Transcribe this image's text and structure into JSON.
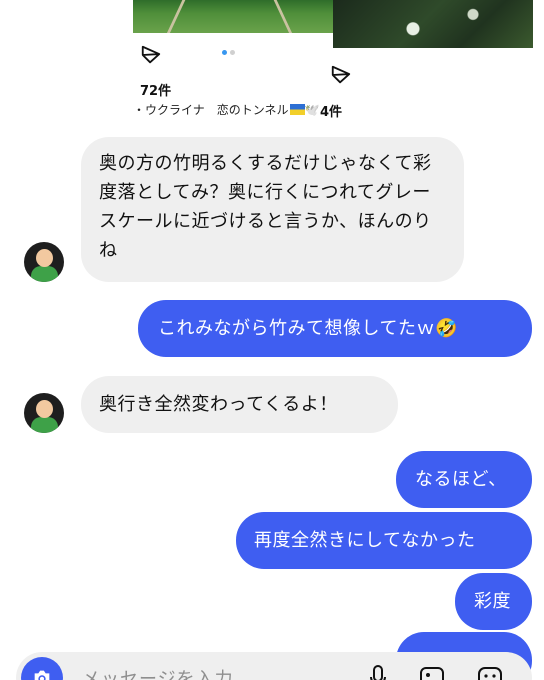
{
  "posts": [
    {
      "count": "72件",
      "caption_prefix": "・ウクライナ　恋のトンネル",
      "caption_suffix": "🕊️"
    },
    {
      "count": "4件"
    }
  ],
  "messages": [
    {
      "from": "other",
      "text": "奥の方の竹明るくするだけじゃなくて彩度落としてみ？奥に行くにつれてグレースケールに近づけると言うか、ほんのりね"
    },
    {
      "from": "me",
      "text": "これみながら竹みて想像してたｗ🤣"
    },
    {
      "from": "other",
      "text": "奥行き全然変わってくるよ！"
    },
    {
      "from": "me",
      "text": "なるほど、"
    },
    {
      "from": "me",
      "text": "再度全然きにしてなかった"
    },
    {
      "from": "me",
      "text": "彩度"
    },
    {
      "from": "me",
      "text": ""
    }
  ],
  "composer": {
    "placeholder": "メッセージを入力..."
  },
  "colors": {
    "outgoing": "#3f5ef1",
    "incoming": "#efefef",
    "carousel_active": "#3897f0"
  },
  "icons": [
    "share-icon",
    "camera-icon",
    "microphone-icon",
    "gallery-icon",
    "sticker-icon"
  ]
}
